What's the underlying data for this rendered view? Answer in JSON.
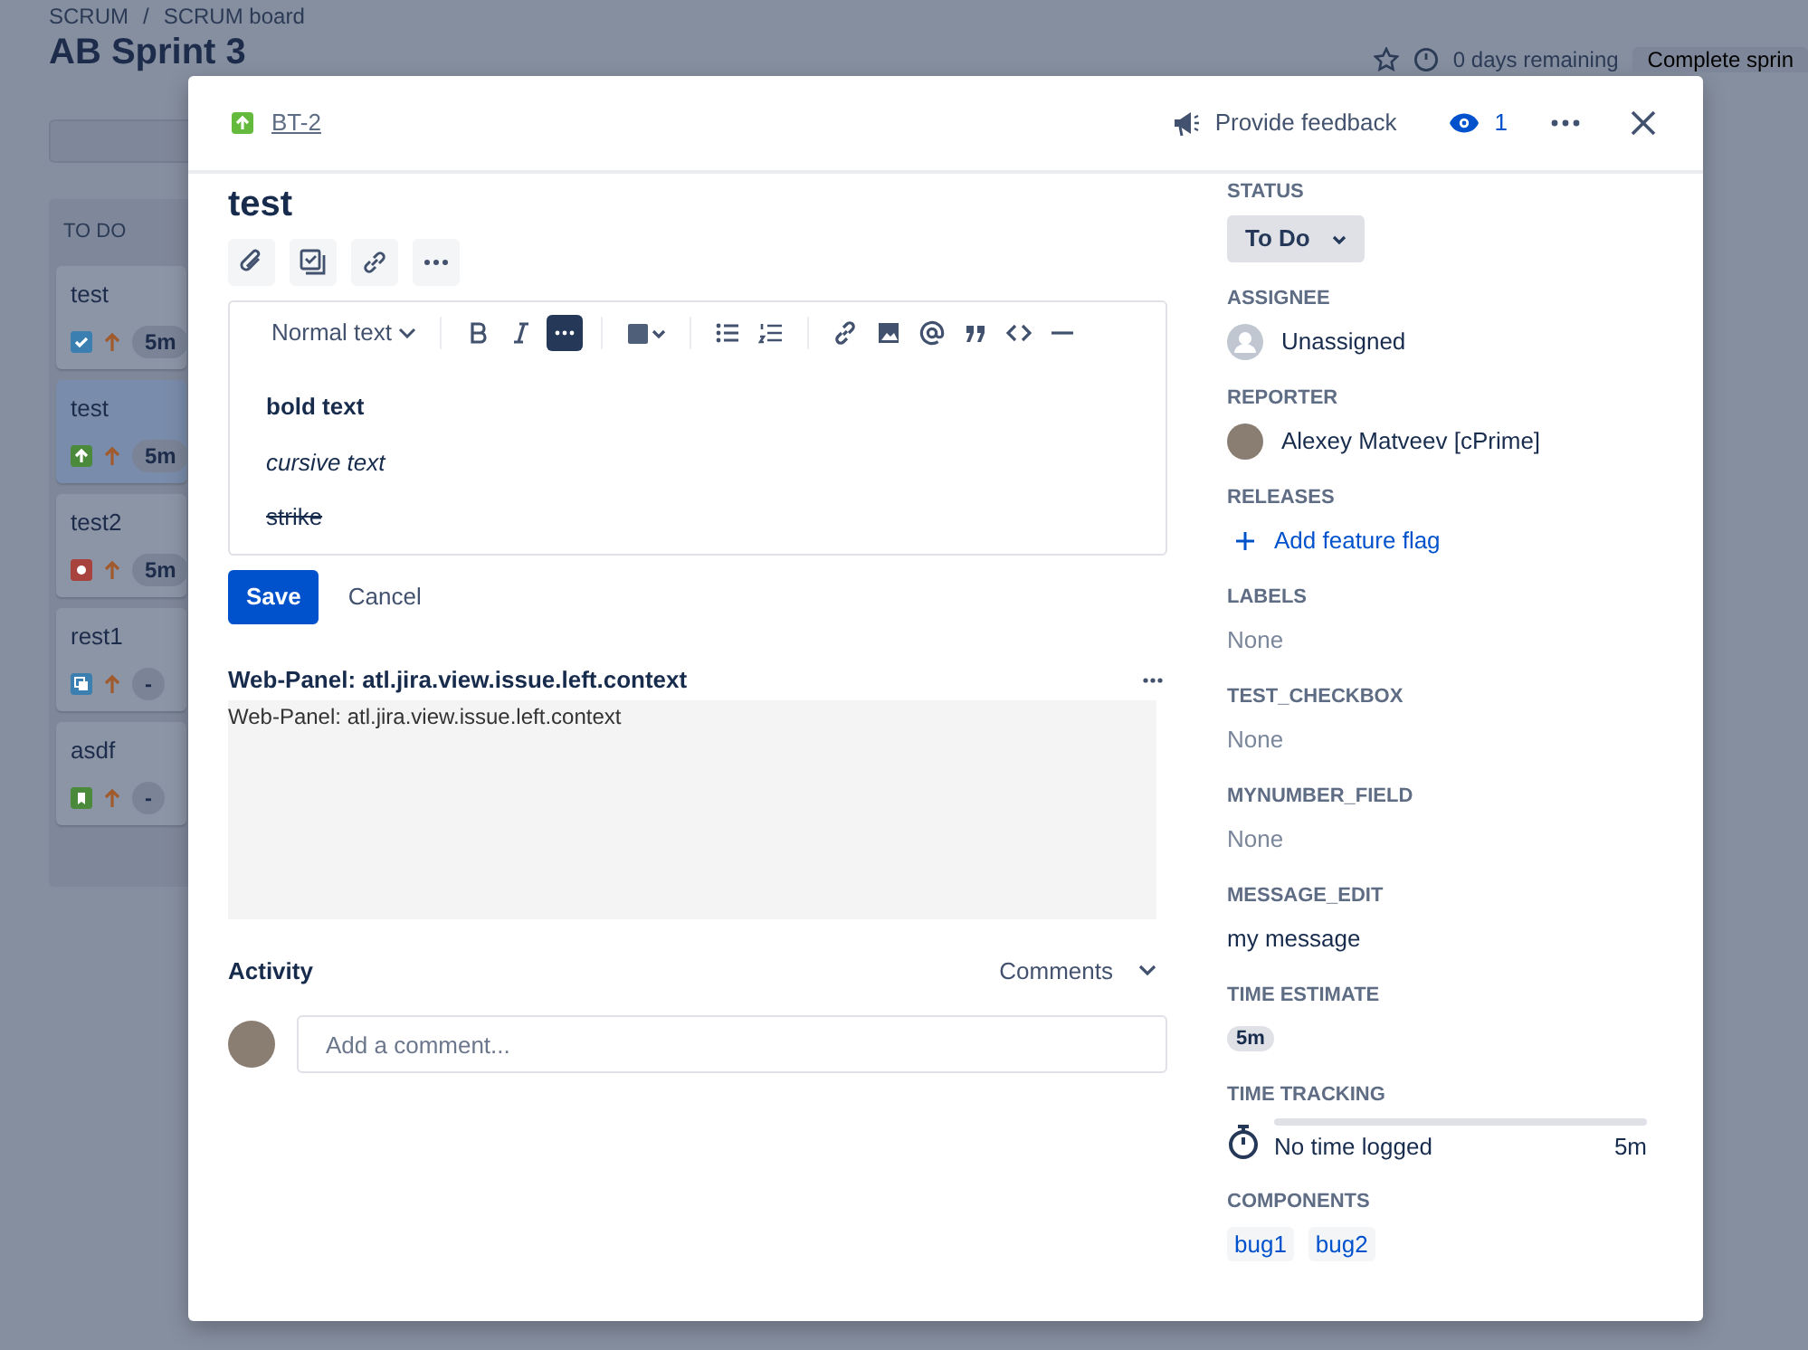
{
  "background": {
    "breadcrumbs": [
      "SCRUM",
      "SCRUM board"
    ],
    "breadcrumb_separator": "/",
    "sprint_title": "AB Sprint 3",
    "days_remaining": "0 days remaining",
    "complete_button": "Complete sprin",
    "column": {
      "title": "TO DO",
      "cards": [
        {
          "title": "test",
          "kind": "task",
          "estimate": "5m",
          "selected": false
        },
        {
          "title": "test",
          "kind": "improvement",
          "estimate": "5m",
          "selected": true
        },
        {
          "title": "test2",
          "kind": "bug",
          "estimate": "5m",
          "selected": false
        },
        {
          "title": "rest1",
          "kind": "subtask",
          "estimate": "-",
          "selected": false
        },
        {
          "title": "asdf",
          "kind": "story",
          "estimate": "-",
          "selected": false
        }
      ]
    }
  },
  "modal": {
    "issue_icon": {
      "kind": "improvement"
    },
    "issue_key": "BT-2",
    "feedback": "Provide feedback",
    "watchers": "1",
    "title": "test",
    "editor": {
      "text_style": "Normal text",
      "paragraphs": [
        {
          "kind": "bold",
          "text": "bold text"
        },
        {
          "kind": "italic",
          "text": "cursive text"
        },
        {
          "kind": "strike",
          "text": "strike"
        }
      ],
      "save": "Save",
      "cancel": "Cancel"
    },
    "web_panel": {
      "title": "Web-Panel: atl.jira.view.issue.left.context",
      "body": "Web-Panel: atl.jira.view.issue.left.context"
    },
    "activity": {
      "title": "Activity",
      "filter": "Comments",
      "comment_placeholder": "Add a comment..."
    },
    "fields": [
      {
        "kind": "status",
        "label": "STATUS",
        "value": "To Do"
      },
      {
        "kind": "user",
        "label": "ASSIGNEE",
        "value": "Unassigned",
        "avatar": {
          "kind": "empty"
        }
      },
      {
        "kind": "user",
        "label": "REPORTER",
        "value": "Alexey Matveev [cPrime]",
        "avatar": {
          "kind": "photo"
        }
      },
      {
        "kind": "link",
        "label": "RELEASES",
        "value": "Add feature flag"
      },
      {
        "kind": "none",
        "label": "LABELS",
        "value": "None"
      },
      {
        "kind": "none",
        "label": "TEST_CHECKBOX",
        "value": "None"
      },
      {
        "kind": "none",
        "label": "MYNUMBER_FIELD",
        "value": "None"
      },
      {
        "kind": "text",
        "label": "MESSAGE_EDIT",
        "value": "my message"
      },
      {
        "kind": "badge",
        "label": "TIME ESTIMATE",
        "value": "5m"
      },
      {
        "kind": "tracking",
        "label": "TIME TRACKING",
        "logged": "No time logged",
        "remaining": "5m",
        "level": 0
      },
      {
        "kind": "tags",
        "label": "COMPONENTS",
        "tags": [
          "bug1",
          "bug2"
        ]
      }
    ]
  }
}
